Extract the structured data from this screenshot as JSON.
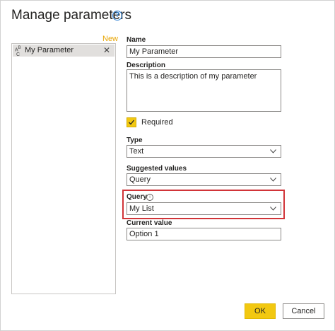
{
  "dialog": {
    "title": "Manage parameters",
    "help_icon": "?"
  },
  "list": {
    "new_label": "New",
    "items": [
      {
        "label": "My Parameter",
        "icon": "abc-type-icon"
      }
    ]
  },
  "form": {
    "name_label": "Name",
    "name_value": "My Parameter",
    "description_label": "Description",
    "description_value": "This is a description of my parameter",
    "required_label": "Required",
    "required_checked": true,
    "type_label": "Type",
    "type_value": "Text",
    "suggested_label": "Suggested values",
    "suggested_value": "Query",
    "query_label": "Query",
    "query_info": "i",
    "query_value": "My List",
    "current_label": "Current value",
    "current_value": "Option 1"
  },
  "buttons": {
    "ok": "OK",
    "cancel": "Cancel"
  },
  "colors": {
    "accent": "#f2c811",
    "highlight": "#d13438",
    "new_link": "#e8a400"
  }
}
